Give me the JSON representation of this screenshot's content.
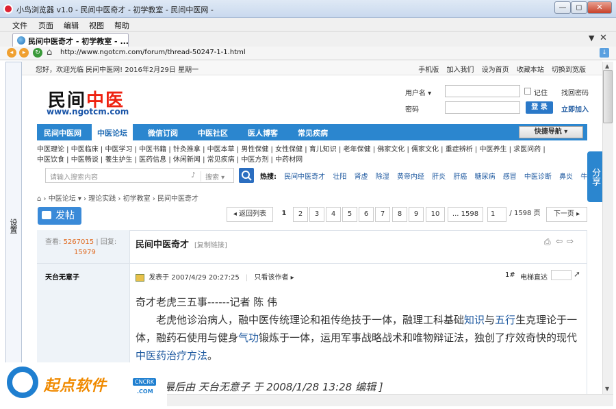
{
  "window": {
    "title": "小鸟浏览器 v1.0 - 民间中医奇才 - 初学教室 - 民间中医网 -"
  },
  "menu": [
    "文件",
    "页面",
    "编辑",
    "视图",
    "帮助"
  ],
  "tab": {
    "label": "民间中医奇才 - 初学教室 - ..."
  },
  "address": {
    "url": "http://www.ngotcm.com/forum/thread-50247-1-1.html"
  },
  "sidebar": {
    "label": "设置"
  },
  "topbar": {
    "welcome": "您好，欢迎光临 民间中医网! 2016年2月29日 星期一",
    "links": [
      "手机版",
      "加入我们",
      "设为首页",
      "收藏本站",
      "切换到宽版"
    ]
  },
  "logo": {
    "part1": "民间",
    "part2": "中医",
    "url": "www.ngotcm.com"
  },
  "login": {
    "username_label": "用户名 ▾",
    "password_label": "密码",
    "remember": "记住",
    "find_password": "找回密码",
    "login_button": "登 录",
    "register": "立即加入"
  },
  "nav": {
    "items": [
      "民间中医网",
      "中医论坛",
      "微信订阅",
      "中医社区",
      "医人博客",
      "常见疾病"
    ],
    "quick_nav": "快捷导航"
  },
  "subnav_row1": "中医理论 | 中医临床 | 中医学习 | 中医书籍 | 针灸推拿 | 中医本草 | 男性保健 | 女性保健 | 育儿知识 | 老年保健 | 佛家文化 | 儒家文化 | 重症辨析 | 中医养生 | 求医问药 |",
  "subnav_row2": "中医饮食 | 中医畅谈 | 養生护生 | 医药信息 | 休闲新闻 | 常见疾病 | 中医方剂 | 中药材网",
  "search": {
    "placeholder": "请输入搜索内容",
    "scope": "搜索 ▾",
    "hot_label": "热搜:",
    "hot": [
      "民间中医奇才",
      "壮阳",
      "肾虚",
      "除湿",
      "黄帝内经",
      "肝炎",
      "肝癌",
      "糖尿病",
      "感冒",
      "中医诊断",
      "鼻炎",
      "牛皮癣"
    ]
  },
  "breadcrumb": [
    "中医论坛 ▾",
    "理论实践",
    "初学教室",
    "民间中医奇才"
  ],
  "post_button": "发帖",
  "pagination": {
    "back": "◂ 返回列表",
    "pages": [
      "1",
      "2",
      "3",
      "4",
      "5",
      "6",
      "7",
      "8",
      "9",
      "10"
    ],
    "last": "... 1598",
    "input_value": "1",
    "total": "/ 1598 页",
    "next": "下一页 ▸"
  },
  "stats": {
    "views_label": "查看:",
    "views": "5267015",
    "replies_label": "| 回复:",
    "replies": "15979"
  },
  "post": {
    "title": "民间中医奇才",
    "copy_link": "[复制链接]",
    "author": "天台无意子",
    "posted": "发表于 2007/4/29 20:27:25",
    "only_author": "只看该作者 ▸",
    "floor": "1#",
    "elevator": "电梯直达",
    "content_line1": "奇才老虎三五事------记者 陈 伟",
    "content_p1a": "　　老虎他诊治病人，融中医传统理论和祖传绝技于一体，融理工科基础",
    "content_k1": "知识",
    "content_and": "与",
    "content_k2": "五行",
    "content_p1b": "生克理论于一体，融药石使用与健身",
    "content_k3": "气功",
    "content_p1c": "锻炼于一体，运用军事战略战术和唯物辩证法，独创了疗效奇快的现代",
    "content_k4": "中医药治疗方法",
    "content_end": "。",
    "edit_note": "最后由 天台无意子 于 2008/1/28 13:28 编辑 ]"
  },
  "share": "分享",
  "watermark": {
    "brand": "起点软件",
    "badge": "CNCRK",
    "domain": ".COM"
  }
}
